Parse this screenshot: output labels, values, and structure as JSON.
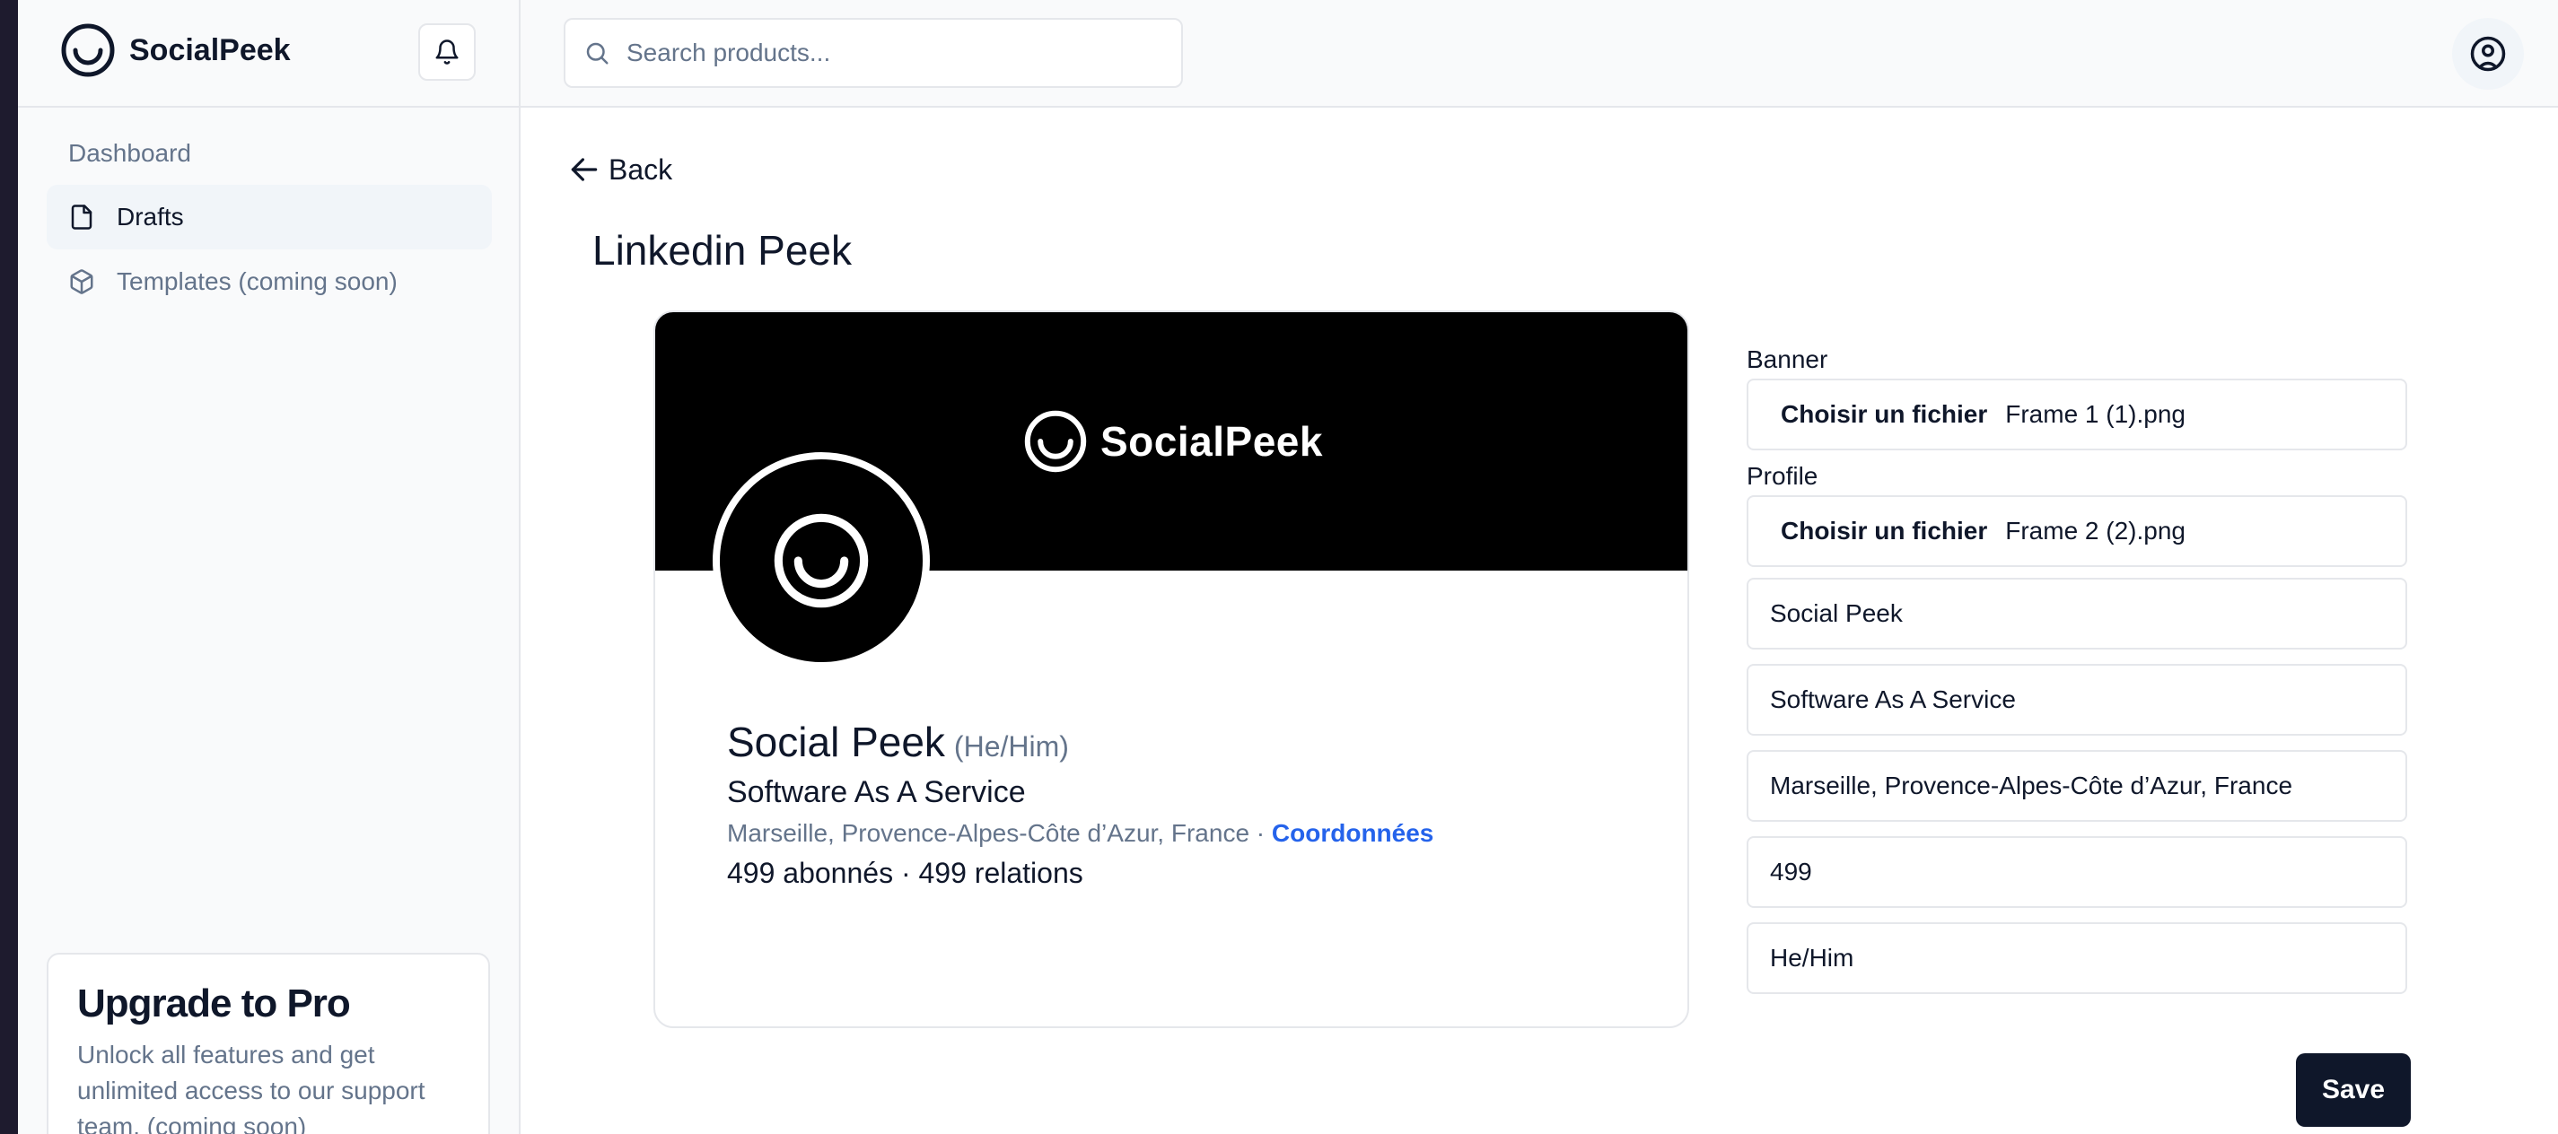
{
  "app": {
    "name": "SocialPeek"
  },
  "sidebar": {
    "section_title": "Dashboard",
    "items": [
      {
        "label": "Drafts",
        "icon": "file-icon",
        "active": true
      },
      {
        "label": "Templates (coming soon)",
        "icon": "package-icon",
        "active": false
      }
    ],
    "upgrade": {
      "title": "Upgrade to Pro",
      "text": "Unlock all features and get unlimited access to our support team. (coming soon)"
    }
  },
  "topbar": {
    "search_placeholder": "Search products...",
    "icons": [
      "search-icon",
      "bell-icon",
      "user-circle-icon"
    ]
  },
  "main": {
    "back_label": "Back",
    "title": "Linkedin Peek",
    "preview": {
      "banner_brand": "SocialPeek",
      "name": "Social Peek",
      "pronouns": "(He/Him)",
      "headline": "Software As A Service",
      "location": "Marseille, Provence-Alpes-Côte d’Azur, France",
      "location_separator": " · ",
      "contact_link": "Coordonnées",
      "stats": "499 abonnés · 499 relations"
    },
    "form": {
      "banner_label": "Banner",
      "banner_button": "Choisir un fichier",
      "banner_file": "Frame 1 (1).png",
      "profile_label": "Profile",
      "profile_button": "Choisir un fichier",
      "profile_file": "Frame 2 (2).png",
      "name_value": "Social Peek",
      "headline_value": "Software As A Service",
      "location_value": "Marseille, Provence-Alpes-Côte d’Azur, France",
      "followers_value": "499",
      "pronouns_value": "He/Him",
      "save_label": "Save"
    }
  },
  "colors": {
    "primary": "#0f172a",
    "link": "#2563eb",
    "muted": "#64748b",
    "border": "#e5e7eb",
    "banner": "#000000"
  }
}
